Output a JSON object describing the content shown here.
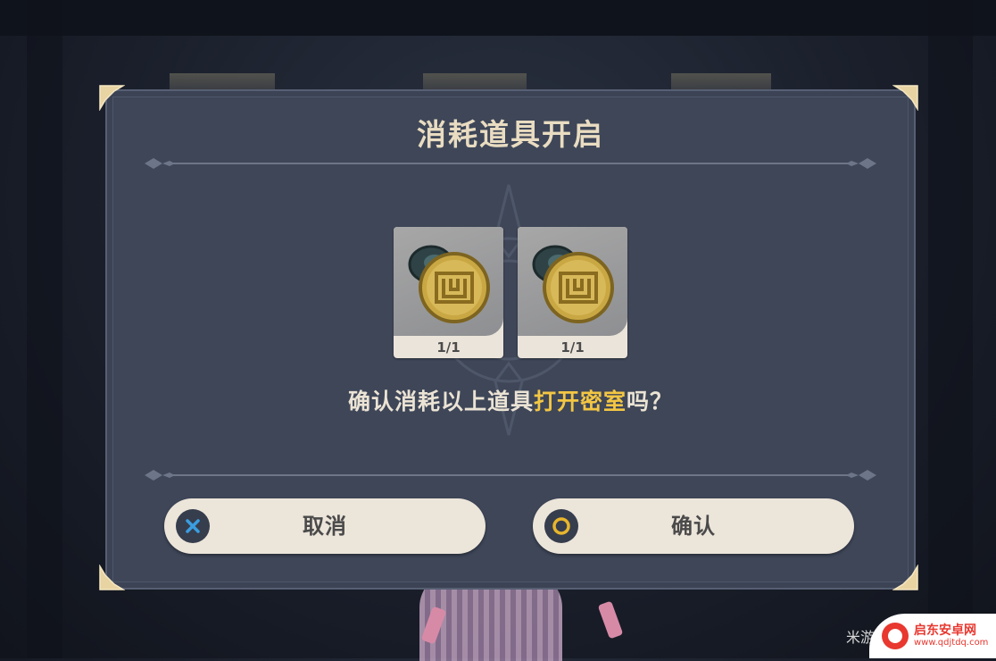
{
  "dialog": {
    "title": "消耗道具开启",
    "items": [
      {
        "count": "1/1",
        "icon": "maze-medallion-icon"
      },
      {
        "count": "1/1",
        "icon": "maze-medallion-icon"
      }
    ],
    "question": {
      "prefix": "确认消耗以上道具",
      "highlight": "打开密室",
      "suffix": "吗？"
    },
    "buttons": {
      "cancel": {
        "label": "取消",
        "icon": "cross-icon"
      },
      "confirm": {
        "label": "确认",
        "icon": "circle-icon"
      }
    }
  },
  "watermark": {
    "left_text": "米游",
    "brand": "启东安卓网",
    "url": "www.qdjtdq.com"
  },
  "colors": {
    "panel": "#3e4658",
    "title": "#e9dcc1",
    "highlight": "#f3c643",
    "button_bg": "#ece5da",
    "cancel_icon": "#3a9ee0",
    "confirm_icon": "#e8b52c"
  }
}
